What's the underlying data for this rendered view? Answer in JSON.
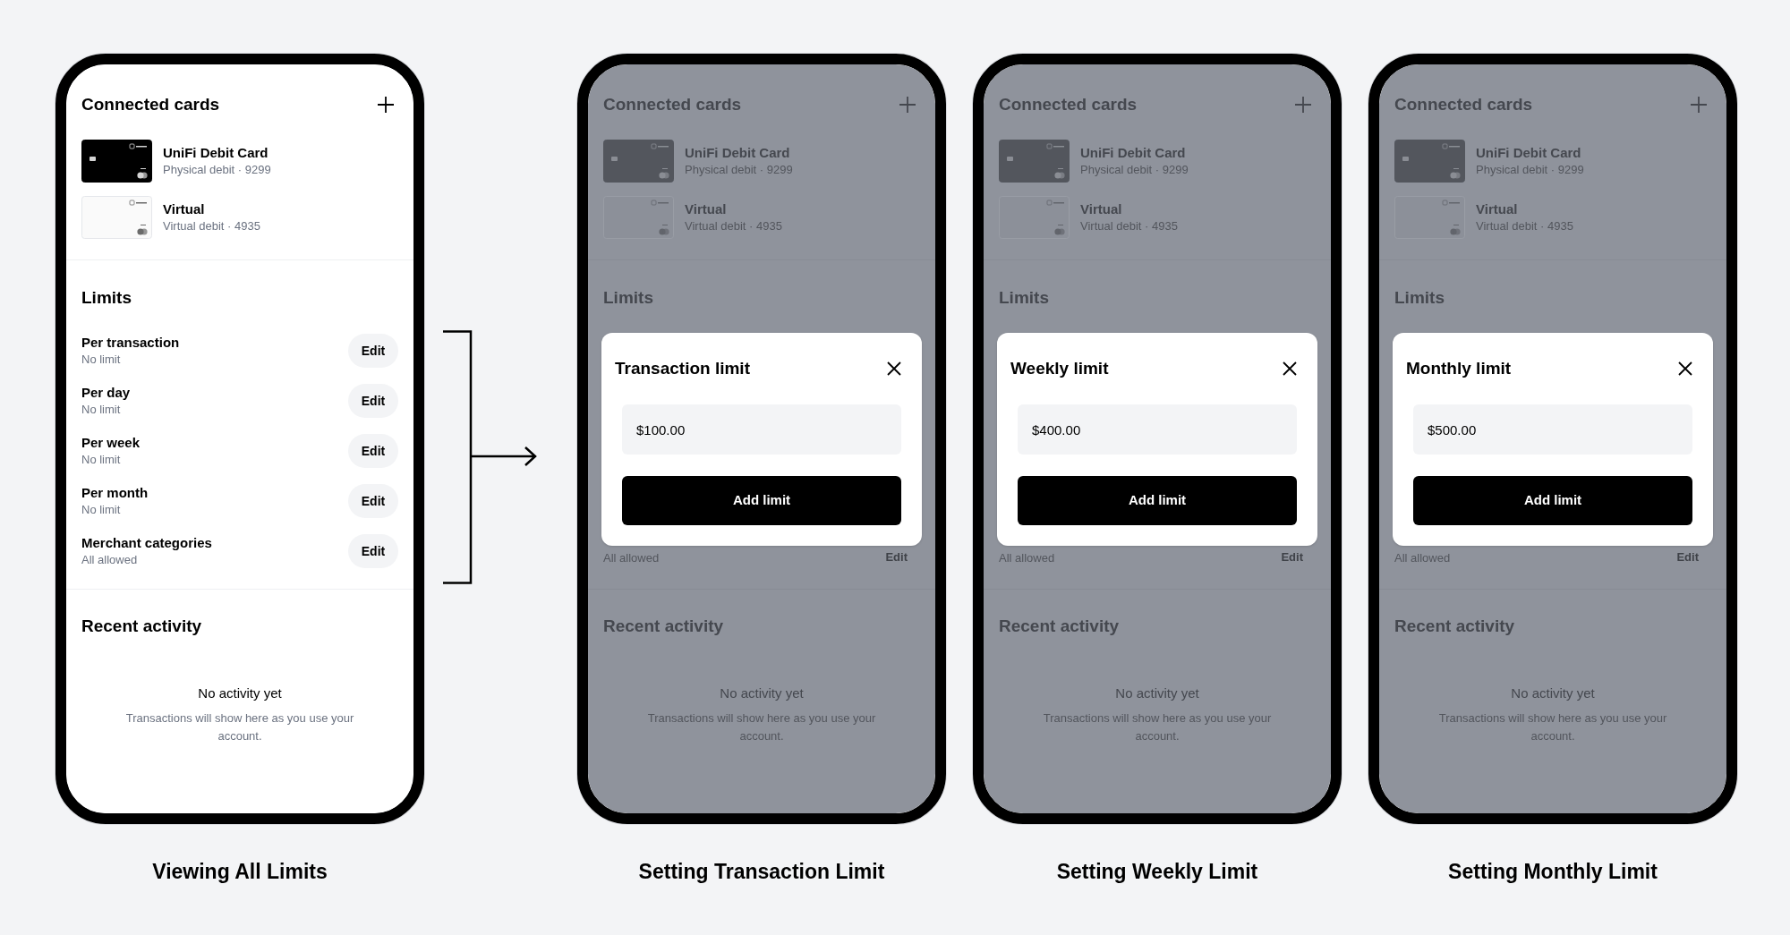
{
  "screens": [
    {
      "caption": "Viewing All Limits",
      "dimmed": false,
      "title": "Connected cards",
      "cards": [
        {
          "kind": "physical",
          "name": "UniFi Debit Card",
          "detail": "Physical debit · 9299"
        },
        {
          "kind": "virtual",
          "name": "Virtual",
          "detail": "Virtual debit · 4935"
        }
      ],
      "limits_title": "Limits",
      "rows": [
        {
          "label": "Per transaction",
          "value": "No limit",
          "button": "Edit"
        },
        {
          "label": "Per day",
          "value": "No limit",
          "button": "Edit"
        },
        {
          "label": "Per week",
          "value": "No limit",
          "button": "Edit"
        },
        {
          "label": "Per month",
          "value": "No limit",
          "button": "Edit"
        },
        {
          "label": "Merchant categories",
          "value": "All allowed",
          "button": "Edit"
        }
      ],
      "activity": {
        "title": "Recent activity",
        "empty_title": "No activity yet",
        "empty_text": "Transactions will show here as you use your account."
      }
    },
    {
      "caption": "Setting Transaction Limit",
      "dimmed": true,
      "title": "Connected cards",
      "cards": [
        {
          "kind": "physical",
          "name": "UniFi Debit Card",
          "detail": "Physical debit · 9299"
        },
        {
          "kind": "virtual",
          "name": "Virtual",
          "detail": "Virtual debit · 4935"
        }
      ],
      "limits_title": "Limits",
      "modal": {
        "title": "Transaction limit",
        "amount": "$100.00",
        "button": "Add limit"
      },
      "rows": [
        {
          "value": "All allowed",
          "button": "Edit"
        }
      ],
      "activity": {
        "title": "Recent activity",
        "empty_title": "No activity yet",
        "empty_text": "Transactions will show here as you use your account."
      }
    },
    {
      "caption": "Setting Weekly Limit",
      "dimmed": true,
      "title": "Connected cards",
      "cards": [
        {
          "kind": "physical",
          "name": "UniFi Debit Card",
          "detail": "Physical debit · 9299"
        },
        {
          "kind": "virtual",
          "name": "Virtual",
          "detail": "Virtual debit · 4935"
        }
      ],
      "limits_title": "Limits",
      "modal": {
        "title": "Weekly limit",
        "amount": "$400.00",
        "button": "Add limit"
      },
      "rows": [
        {
          "value": "All allowed",
          "button": "Edit"
        }
      ],
      "activity": {
        "title": "Recent activity",
        "empty_title": "No activity yet",
        "empty_text": "Transactions will show here as you use your account."
      }
    },
    {
      "caption": "Setting Monthly Limit",
      "dimmed": true,
      "title": "Connected cards",
      "cards": [
        {
          "kind": "physical",
          "name": "UniFi Debit Card",
          "detail": "Physical debit · 9299"
        },
        {
          "kind": "virtual",
          "name": "Virtual",
          "detail": "Virtual debit · 4935"
        }
      ],
      "limits_title": "Limits",
      "modal": {
        "title": "Monthly limit",
        "amount": "$500.00",
        "button": "Add limit"
      },
      "rows": [
        {
          "value": "All allowed",
          "button": "Edit"
        }
      ],
      "activity": {
        "title": "Recent activity",
        "empty_title": "No activity yet",
        "empty_text": "Transactions will show here as you use your account."
      }
    }
  ]
}
